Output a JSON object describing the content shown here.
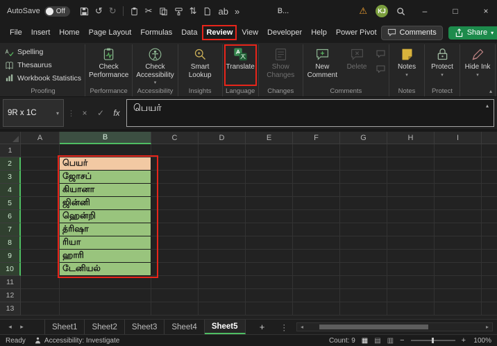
{
  "theme": {
    "annotation_red": "#e8251a",
    "selection_green": "#4fbe63",
    "share_green": "#1d8b4c",
    "header_fill": "#f2c9a3",
    "data_fill": "#99c47d",
    "warning_orange": "#f0a030",
    "avatar_green": "#7b9e3e"
  },
  "title_bar": {
    "autosave_label": "AutoSave",
    "autosave_state": "Off",
    "doc_title": "B...",
    "avatar_initials": "KJ"
  },
  "icons": {
    "undo": "↺",
    "redo": "↻",
    "cut": "✂",
    "sort": "⇅",
    "strikethrough": "ab",
    "chevron_more": "»",
    "warning": "⚠",
    "minimize": "–",
    "maximize": "□",
    "close": "×",
    "caret_down": "▾",
    "caret_up": "▴",
    "dots_vertical": "⋮",
    "cross": "×",
    "check": "✓",
    "nav_left": "◂",
    "nav_right": "▸",
    "view_normal": "▦",
    "view_layout": "▤",
    "view_break": "▥",
    "zoom_out": "−",
    "zoom_in": "+"
  },
  "ribbon_tabs": [
    {
      "label": "File"
    },
    {
      "label": "Insert"
    },
    {
      "label": "Home"
    },
    {
      "label": "Page Layout"
    },
    {
      "label": "Formulas"
    },
    {
      "label": "Data"
    },
    {
      "label": "Review",
      "active": true,
      "boxed": true
    },
    {
      "label": "View"
    },
    {
      "label": "Developer"
    },
    {
      "label": "Help"
    },
    {
      "label": "Power Pivot"
    }
  ],
  "tab_actions": {
    "comments": "Comments",
    "share": "Share"
  },
  "ribbon": {
    "spelling": "Spelling",
    "thesaurus": "Thesaurus",
    "workbook_statistics": "Workbook Statistics",
    "check_performance": "Check Performance",
    "check_accessibility": "Check Accessibility",
    "smart_lookup": "Smart Lookup",
    "translate": "Translate",
    "show_changes": "Show Changes",
    "new_comment": "New Comment",
    "delete": "Delete",
    "notes": "Notes",
    "protect": "Protect",
    "hide_ink": "Hide Ink",
    "labels": {
      "proofing": "Proofing",
      "performance": "Performance",
      "accessibility": "Accessibility",
      "insights": "Insights",
      "language": "Language",
      "changes": "Changes",
      "comments": "Comments",
      "notes": "Notes",
      "protect": "Protect"
    }
  },
  "formula_bar": {
    "name_box": "9R x 1C",
    "fx": "fx",
    "content": "பெயர்"
  },
  "grid": {
    "columns": [
      "A",
      "B",
      "C",
      "D",
      "E",
      "F",
      "G",
      "H",
      "I"
    ],
    "selected_column": "B",
    "row_count": 13,
    "selected_rows": [
      2,
      10
    ],
    "cells": [
      {
        "col": "B",
        "row": 2,
        "text": "பெயர்",
        "type": "header"
      },
      {
        "col": "B",
        "row": 3,
        "text": "ஜோசப்",
        "type": "data"
      },
      {
        "col": "B",
        "row": 4,
        "text": "கியானா",
        "type": "data"
      },
      {
        "col": "B",
        "row": 5,
        "text": "ஜின்னி",
        "type": "data"
      },
      {
        "col": "B",
        "row": 6,
        "text": "ஹென்றி",
        "type": "data"
      },
      {
        "col": "B",
        "row": 7,
        "text": "த்ரிஷா",
        "type": "data"
      },
      {
        "col": "B",
        "row": 8,
        "text": "ரியா",
        "type": "data"
      },
      {
        "col": "B",
        "row": 9,
        "text": "ஹாரி",
        "type": "data"
      },
      {
        "col": "B",
        "row": 10,
        "text": "டேனியல்",
        "type": "data"
      }
    ]
  },
  "sheet_bar": {
    "tabs": [
      "Sheet1",
      "Sheet2",
      "Sheet3",
      "Sheet4",
      "Sheet5"
    ],
    "active_tab": "Sheet5",
    "add_label": "+"
  },
  "status_bar": {
    "ready": "Ready",
    "accessibility": "Accessibility: Investigate",
    "count": "Count: 9",
    "zoom": "100%"
  }
}
